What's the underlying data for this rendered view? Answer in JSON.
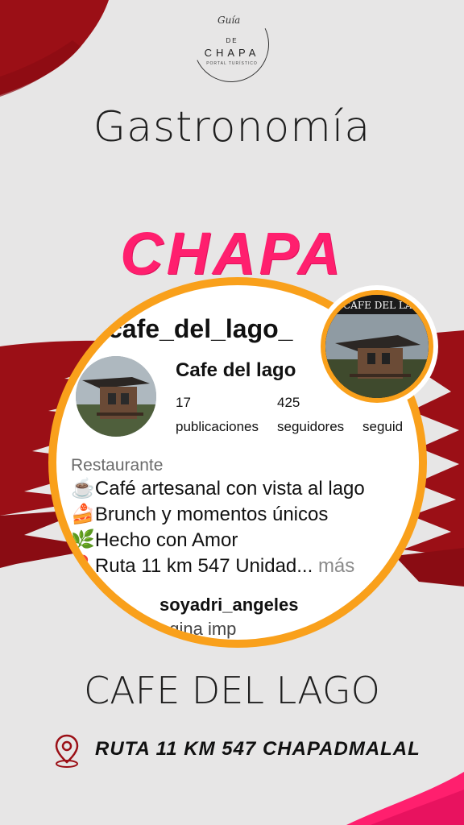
{
  "logo": {
    "script": "Guía",
    "de": "DE",
    "name": "CHAPA",
    "tagline": "PORTAL TURÍSTICO"
  },
  "heading": "Gastronomía",
  "subheading": "CHAPA",
  "instagram": {
    "handle": "cafe_del_lago_",
    "name": "Cafe del lago",
    "posts_count": "17",
    "followers_count": "425",
    "posts_label": "publicaciones",
    "followers_label": "seguidores",
    "following_label": "seguid",
    "category": "Restaurante",
    "bio": [
      {
        "icon": "☕",
        "text": "Café artesanal con vista al lago"
      },
      {
        "icon": "🍰",
        "text": "Brunch y momentos únicos"
      },
      {
        "icon": "🌿",
        "text": "Hecho con Amor"
      },
      {
        "icon": "📍",
        "text": "Ruta 11 km 547 Unidad...",
        "more": "más"
      }
    ],
    "comment_user": "soyadri_angeles",
    "comment_text": "agina imp"
  },
  "photo_sign": "CAFE DEL LAGO",
  "place_name": "CAFE DEL LAGO",
  "address": "RUTA 11 KM 547 CHAPADMALAL",
  "colors": {
    "accent_pink": "#ff1f6e",
    "accent_orange": "#f9a01b",
    "brush_red": "#9b0f16",
    "background": "#e7e6e6"
  },
  "icons": [
    "location-pin-icon",
    "coffee-icon",
    "cake-icon",
    "leaf-icon",
    "pin-icon"
  ]
}
